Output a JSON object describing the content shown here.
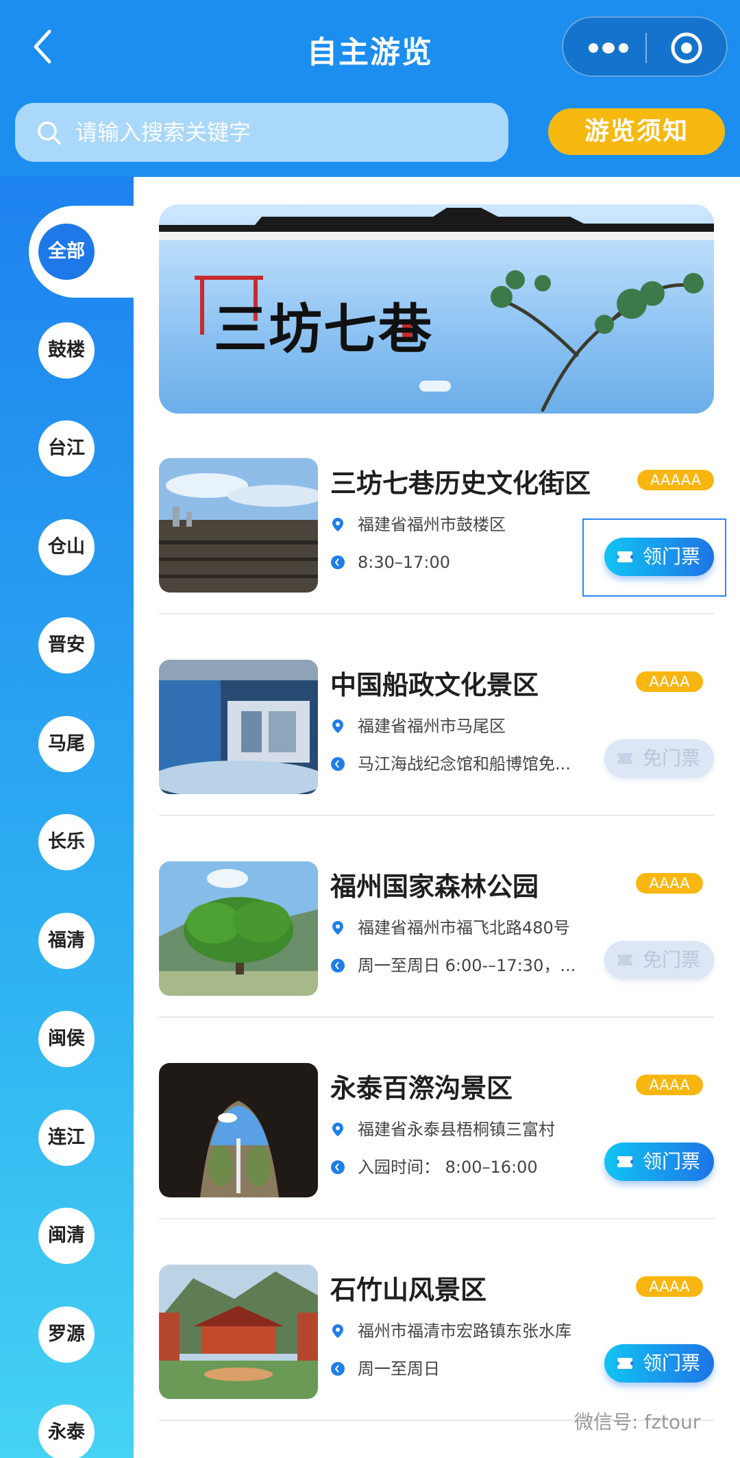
{
  "header": {
    "title": "自主游览",
    "search_placeholder": "请输入搜索关键字",
    "notice_button": "游览须知"
  },
  "sidebar": {
    "regions": [
      "全部",
      "鼓楼",
      "台江",
      "仓山",
      "晋安",
      "马尾",
      "长乐",
      "福清",
      "闽侯",
      "连江",
      "闽清",
      "罗源",
      "永泰"
    ],
    "active": "全部"
  },
  "banner": {
    "title": "三坊七巷"
  },
  "attractions": [
    {
      "name": "三坊七巷历史文化街区",
      "level": "AAAAA",
      "address": "福建省福州市鼓楼区",
      "hours": "8:30–17:00",
      "button": "领门票",
      "button_enabled": true
    },
    {
      "name": "中国船政文化景区",
      "level": "AAAA",
      "address": "福建省福州市马尾区",
      "hours": "马江海战纪念馆和船博馆免...",
      "button": "免门票",
      "button_enabled": false
    },
    {
      "name": "福州国家森林公园",
      "level": "AAAA",
      "address": "福建省福州市福飞北路480号",
      "hours": "周一至周日 6:00-–17:30，...",
      "button": "免门票",
      "button_enabled": false
    },
    {
      "name": "永泰百漈沟景区",
      "level": "AAAA",
      "address": "福建省永泰县梧桐镇三富村",
      "hours": "入园时间：  8:00–16:00",
      "button": "领门票",
      "button_enabled": true
    },
    {
      "name": "石竹山风景区",
      "level": "AAAA",
      "address": "福州市福清市宏路镇东张水库",
      "hours": "周一至周日",
      "button": "领门票",
      "button_enabled": true
    }
  ],
  "watermark": "微信号: fztour",
  "colors": {
    "header_blue": "#1b8ef0",
    "notice_yellow": "#f7b80f",
    "level_badge": "#f9b611",
    "ticket_gradient_start": "#11c4f3",
    "ticket_gradient_end": "#1e74e6"
  }
}
